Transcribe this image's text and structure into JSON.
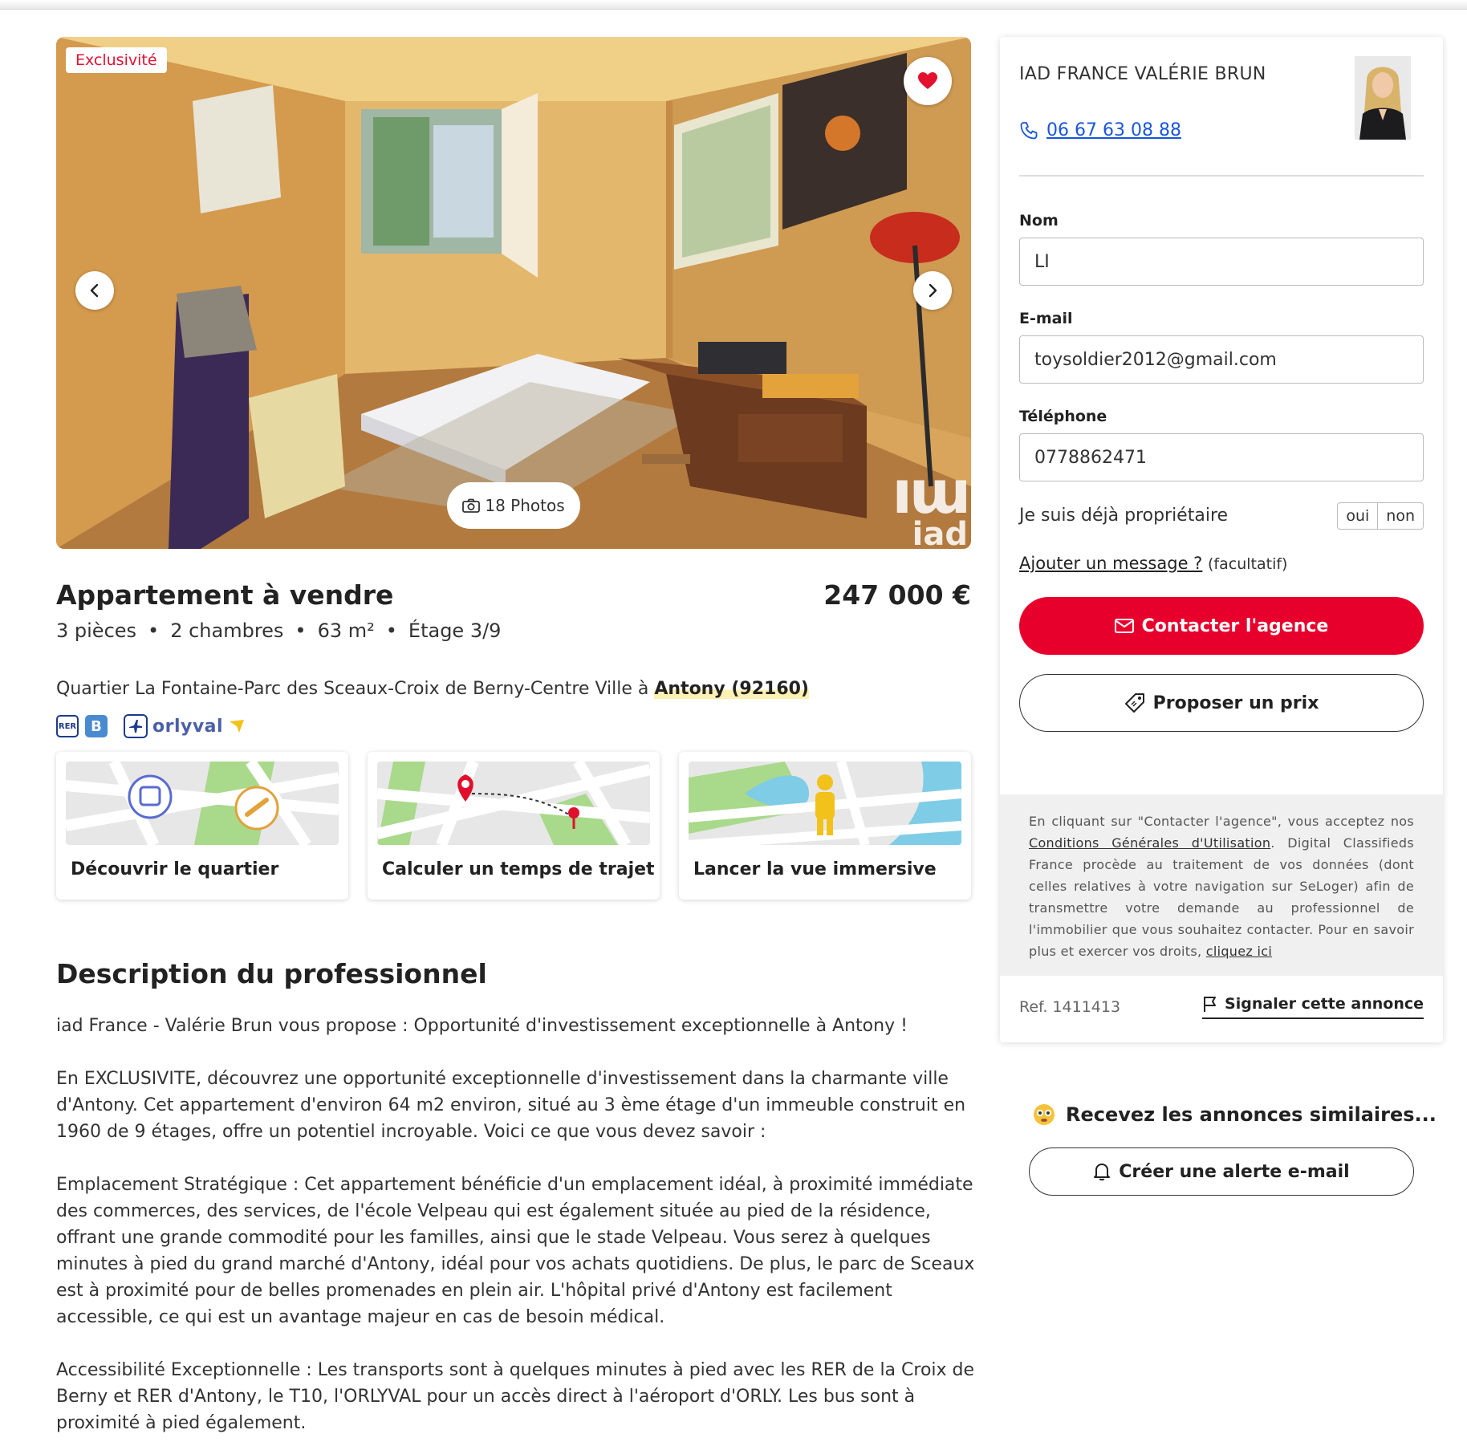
{
  "listing": {
    "badge": "Exclusivité",
    "photos_count_label": "18 Photos",
    "watermark_brand_line1": "iad",
    "title": "Appartement à vendre",
    "price": "247 000 €",
    "specs": [
      "3 pièces",
      "2 chambres",
      "63 m²",
      "Étage 3/9"
    ],
    "spec_separator": "•",
    "location_prefix": "Quartier La Fontaine-Parc des Sceaux-Croix de Berny-Centre Ville à ",
    "location_city": "Antony (92160)",
    "transports": {
      "rer_label": "RER",
      "line_label": "B",
      "orly_label": "orlyval"
    }
  },
  "cards": [
    {
      "label": "Découvrir le quartier",
      "icon": "neighborhood-map-icon"
    },
    {
      "label": "Calculer un temps de trajet",
      "icon": "route-map-icon"
    },
    {
      "label": "Lancer la vue immersive",
      "icon": "street-view-icon"
    }
  ],
  "description": {
    "title": "Description du professionnel",
    "paragraphs": [
      "iad France - Valérie Brun vous propose : Opportunité d'investissement exceptionnelle à Antony !",
      "En EXCLUSIVITE, découvrez une opportunité exceptionnelle d'investissement dans la charmante ville d'Antony. Cet appartement d'environ 64 m2 environ, situé au 3 ème étage d'un immeuble construit en 1960 de 9 étages, offre un potentiel incroyable. Voici ce que vous devez savoir :",
      "Emplacement Stratégique : Cet appartement bénéficie d'un emplacement idéal, à proximité immédiate des commerces, des services, de l'école Velpeau qui est également située au pied de la résidence, offrant une grande commodité pour les familles, ainsi que le stade Velpeau. Vous serez à quelques minutes à pied du grand marché d'Antony, idéal pour vos achats quotidiens. De plus, le parc de Sceaux est à proximité pour de belles promenades en plein air. L'hôpital privé d'Antony est facilement accessible, ce qui est un avantage majeur en cas de besoin médical.",
      "Accessibilité Exceptionnelle : Les transports sont à quelques minutes à pied avec les RER de la Croix de Berny et RER d'Antony, le T10, l'ORLYVAL pour un accès direct à l'aéroport d'ORLY. Les bus sont à proximité à pied également."
    ]
  },
  "agent": {
    "name": "IAD FRANCE VALÉRIE BRUN",
    "phone": "06 67 63 08 88"
  },
  "form": {
    "name_label": "Nom",
    "name_value": "LI",
    "email_label": "E-mail",
    "email_value": "toysoldier2012@gmail.com",
    "phone_label": "Téléphone",
    "phone_value": "0778862471",
    "owner_question": "Je suis déjà propriétaire",
    "owner_yes": "oui",
    "owner_no": "non",
    "add_message_link": "Ajouter un message ?",
    "add_message_optional": "(facultatif)",
    "contact_button": "Contacter l'agence",
    "offer_button": "Proposer un prix"
  },
  "legal": {
    "text_1": "En cliquant sur \"Contacter l'agence\", vous acceptez nos ",
    "cgu_link": "Conditions Générales d'Utilisation",
    "text_2": ". Digital Classifieds France procède au traitement de vos données (dont celles relatives à votre navigation sur SeLoger) afin de transmettre votre demande au professionnel de l'immobilier que vous souhaitez contacter. Pour en savoir plus et exercer vos droits, ",
    "click_here": "cliquez ici"
  },
  "footer_panel": {
    "ref": "Ref. 1411413",
    "report": "Signaler cette annonce"
  },
  "alerts": {
    "title": "Recevez les annonces similaires...",
    "button": "Créer une alerte e-mail"
  },
  "colors": {
    "accent_red": "#e8002c",
    "badge_red": "#e3102f",
    "link_blue": "#1a56db"
  }
}
